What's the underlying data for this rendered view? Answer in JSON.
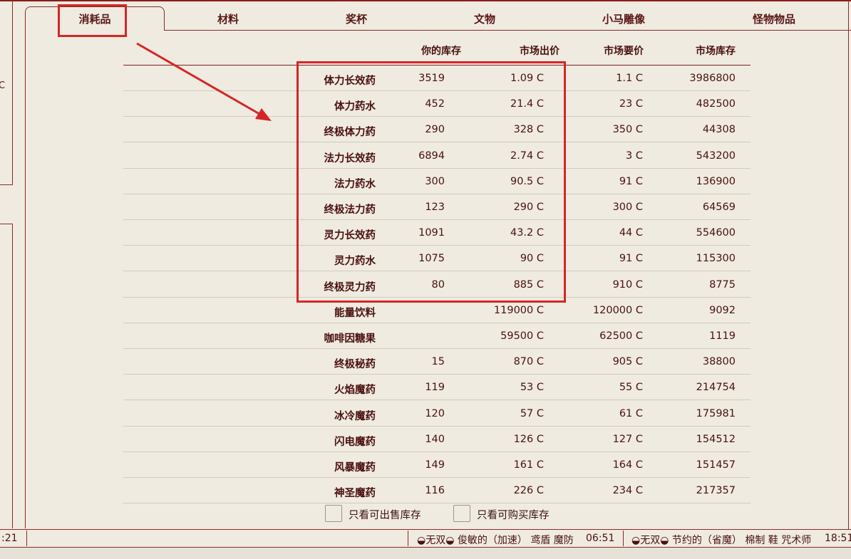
{
  "tabs": [
    {
      "label": "消耗品",
      "active": true
    },
    {
      "label": "材料"
    },
    {
      "label": "奖杯"
    },
    {
      "label": "文物"
    },
    {
      "label": "小马雕像"
    },
    {
      "label": "怪物物品"
    }
  ],
  "left_clip_text": "C",
  "table": {
    "headers": [
      "你的库存",
      "市场出价",
      "市场要价",
      "市场库存"
    ],
    "rows": [
      {
        "name": "体力长效药",
        "stock": "3519",
        "bid": "1.09 C",
        "ask": "1.1 C",
        "market": "3986800"
      },
      {
        "name": "体力药水",
        "stock": "452",
        "bid": "21.4 C",
        "ask": "23 C",
        "market": "482500"
      },
      {
        "name": "终极体力药",
        "stock": "290",
        "bid": "328 C",
        "ask": "350 C",
        "market": "44308"
      },
      {
        "name": "法力长效药",
        "stock": "6894",
        "bid": "2.74 C",
        "ask": "3 C",
        "market": "543200"
      },
      {
        "name": "法力药水",
        "stock": "300",
        "bid": "90.5 C",
        "ask": "91 C",
        "market": "136900"
      },
      {
        "name": "终极法力药",
        "stock": "123",
        "bid": "290 C",
        "ask": "300 C",
        "market": "64569"
      },
      {
        "name": "灵力长效药",
        "stock": "1091",
        "bid": "43.2 C",
        "ask": "44 C",
        "market": "554600"
      },
      {
        "name": "灵力药水",
        "stock": "1075",
        "bid": "90 C",
        "ask": "91 C",
        "market": "115300"
      },
      {
        "name": "终极灵力药",
        "stock": "80",
        "bid": "885 C",
        "ask": "910 C",
        "market": "8775"
      },
      {
        "name": "能量饮料",
        "stock": "",
        "bid": "119000 C",
        "ask": "120000 C",
        "market": "9092"
      },
      {
        "name": "咖啡因糖果",
        "stock": "",
        "bid": "59500 C",
        "ask": "62500 C",
        "market": "1119"
      },
      {
        "name": "终极秘药",
        "stock": "15",
        "bid": "870 C",
        "ask": "905 C",
        "market": "38800"
      },
      {
        "name": "火焰魔药",
        "stock": "119",
        "bid": "53 C",
        "ask": "55 C",
        "market": "214754"
      },
      {
        "name": "冰冷魔药",
        "stock": "120",
        "bid": "57 C",
        "ask": "61 C",
        "market": "175981"
      },
      {
        "name": "闪电魔药",
        "stock": "140",
        "bid": "126 C",
        "ask": "127 C",
        "market": "154512"
      },
      {
        "name": "风暴魔药",
        "stock": "149",
        "bid": "161 C",
        "ask": "164 C",
        "market": "151457"
      },
      {
        "name": "神圣魔药",
        "stock": "116",
        "bid": "226 C",
        "ask": "234 C",
        "market": "217357"
      }
    ]
  },
  "filters": {
    "sellable_label": "只看可出售库存",
    "buyable_label": "只看可购买库存"
  },
  "status": {
    "time_left": ":21",
    "slot1": "◒无双◒ 俊敏的（加速） 鸢盾 魔防",
    "slot1_time": "06:51",
    "slot2": "◒无双◒ 节约的（省魔） 棉制 鞋 咒术师",
    "slot2_time": "18:51"
  },
  "colors": {
    "background": "#efebe0",
    "text": "#5a1616",
    "border": "#8a2a2a",
    "annotation": "#d42626"
  }
}
